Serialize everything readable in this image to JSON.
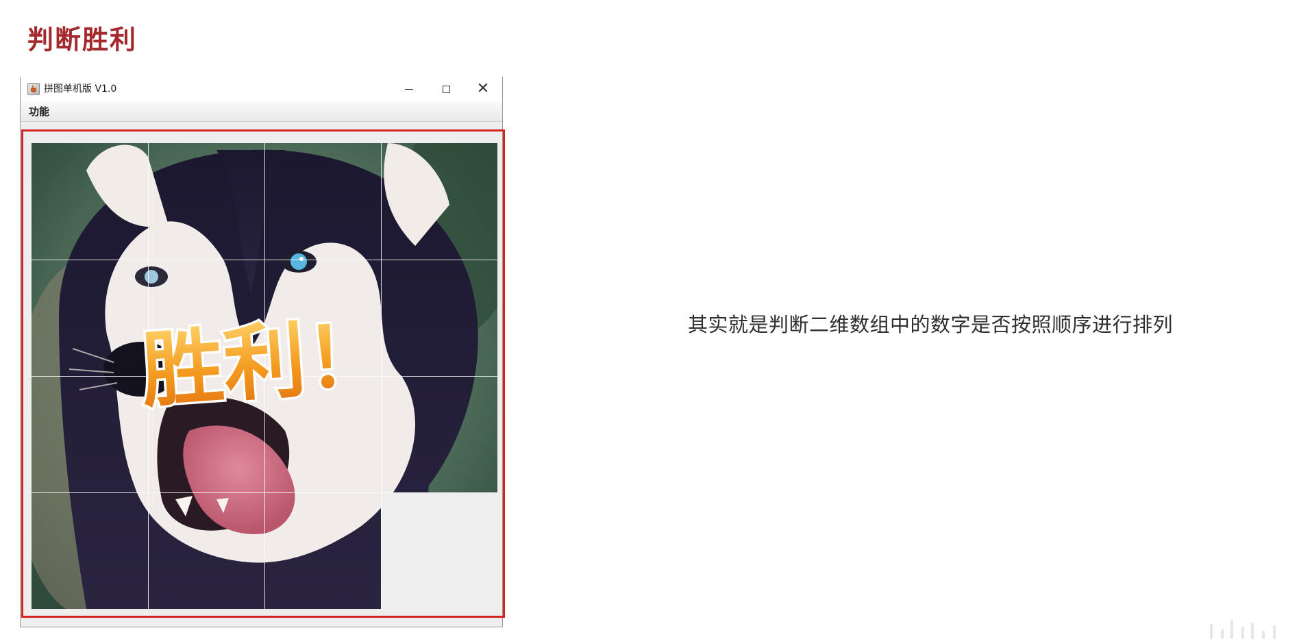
{
  "slide": {
    "title": "判断胜利",
    "caption": "其实就是判断二维数组中的数字是否按照顺序进行排列"
  },
  "window": {
    "title": "拼图单机版 V1.0",
    "icon": "java-cup-icon",
    "controls": [
      "minimize-icon",
      "maximize-icon",
      "close-icon"
    ]
  },
  "menubar": {
    "items": [
      {
        "label": "功能"
      }
    ]
  },
  "puzzle": {
    "grid_size": 4,
    "layout": [
      [
        1,
        2,
        3,
        4
      ],
      [
        5,
        6,
        7,
        8
      ],
      [
        9,
        10,
        11,
        12
      ],
      [
        13,
        14,
        15,
        0
      ]
    ],
    "empty_tile": 0,
    "overlay_text": "胜利！",
    "highlight_color": "#d32323",
    "overlay_color": "#f39a1e"
  },
  "colors": {
    "title": "#a4282c",
    "caption": "#2f2f2f",
    "window_bg": "#eeeeee"
  }
}
